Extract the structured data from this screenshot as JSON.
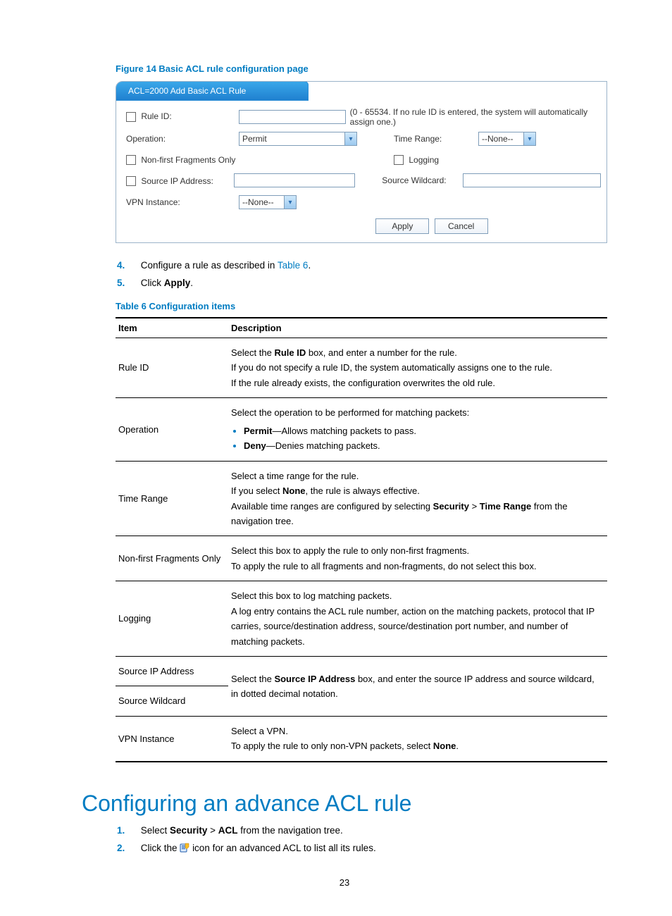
{
  "figure": {
    "caption": "Figure 14 Basic ACL rule configuration page",
    "tab_title": "ACL=2000 Add Basic ACL Rule",
    "rule_id_label": "Rule ID:",
    "rule_id_hint": "(0 - 65534. If no rule ID is entered, the system will automatically assign one.)",
    "operation_label": "Operation:",
    "operation_value": "Permit",
    "time_range_label": "Time Range:",
    "time_range_value": "--None--",
    "nonfirst_label": "Non-first Fragments Only",
    "logging_label": "Logging",
    "srcip_label": "Source IP Address:",
    "src_wildcard_label": "Source Wildcard:",
    "vpn_label": "VPN Instance:",
    "vpn_value": "--None--",
    "apply_btn": "Apply",
    "cancel_btn": "Cancel"
  },
  "steps": {
    "s4_a": "Configure a rule as described in ",
    "s4_link": "Table 6",
    "s4_b": ".",
    "s5_a": "Click ",
    "s5_bold": "Apply",
    "s5_b": "."
  },
  "table": {
    "caption": "Table 6 Configuration items",
    "head_item": "Item",
    "head_desc": "Description",
    "rows": {
      "rule_id": {
        "item": "Rule ID",
        "p1a": "Select the ",
        "p1b": "Rule ID",
        "p1c": " box, and enter a number for the rule.",
        "p2": "If you do not specify a rule ID, the system automatically assigns one to the rule.",
        "p3": "If the rule already exists, the configuration overwrites the old rule."
      },
      "operation": {
        "item": "Operation",
        "p1": "Select the operation to be performed for matching packets:",
        "b1a": "Permit",
        "b1b": "—Allows matching packets to pass.",
        "b2a": "Deny",
        "b2b": "—Denies matching packets."
      },
      "time_range": {
        "item": "Time Range",
        "p1": "Select a time range for the rule.",
        "p2a": "If you select ",
        "p2b": "None",
        "p2c": ", the rule is always effective.",
        "p3a": "Available time ranges are configured by selecting ",
        "p3b": "Security",
        "p3c": " > ",
        "p3d": "Time Range",
        "p3e": " from the navigation tree."
      },
      "nonfirst": {
        "item": "Non-first Fragments Only",
        "p1": "Select this box to apply the rule to only non-first fragments.",
        "p2": "To apply the rule to all fragments and non-fragments, do not select this box."
      },
      "logging": {
        "item": "Logging",
        "p1": "Select this box to log matching packets.",
        "p2": "A log entry contains the ACL rule number, action on the matching packets, protocol that IP carries, source/destination address, source/destination port number, and number of matching packets."
      },
      "srcip": {
        "item": "Source IP Address",
        "desc_a": "Select the ",
        "desc_b": "Source IP Address",
        "desc_c": " box, and enter the source IP address and source wildcard, in dotted decimal notation."
      },
      "srcw": {
        "item": "Source Wildcard"
      },
      "vpn": {
        "item": "VPN Instance",
        "p1": "Select a VPN.",
        "p2a": "To apply the rule to only non-VPN packets, select ",
        "p2b": "None",
        "p2c": "."
      }
    }
  },
  "section_heading": "Configuring an advance ACL rule",
  "steps2": {
    "s1_a": "Select ",
    "s1_b": "Security",
    "s1_c": " > ",
    "s1_d": "ACL",
    "s1_e": " from the navigation tree.",
    "s2_a": "Click the ",
    "s2_b": " icon for an advanced ACL to list all its rules."
  },
  "page_number": "23"
}
